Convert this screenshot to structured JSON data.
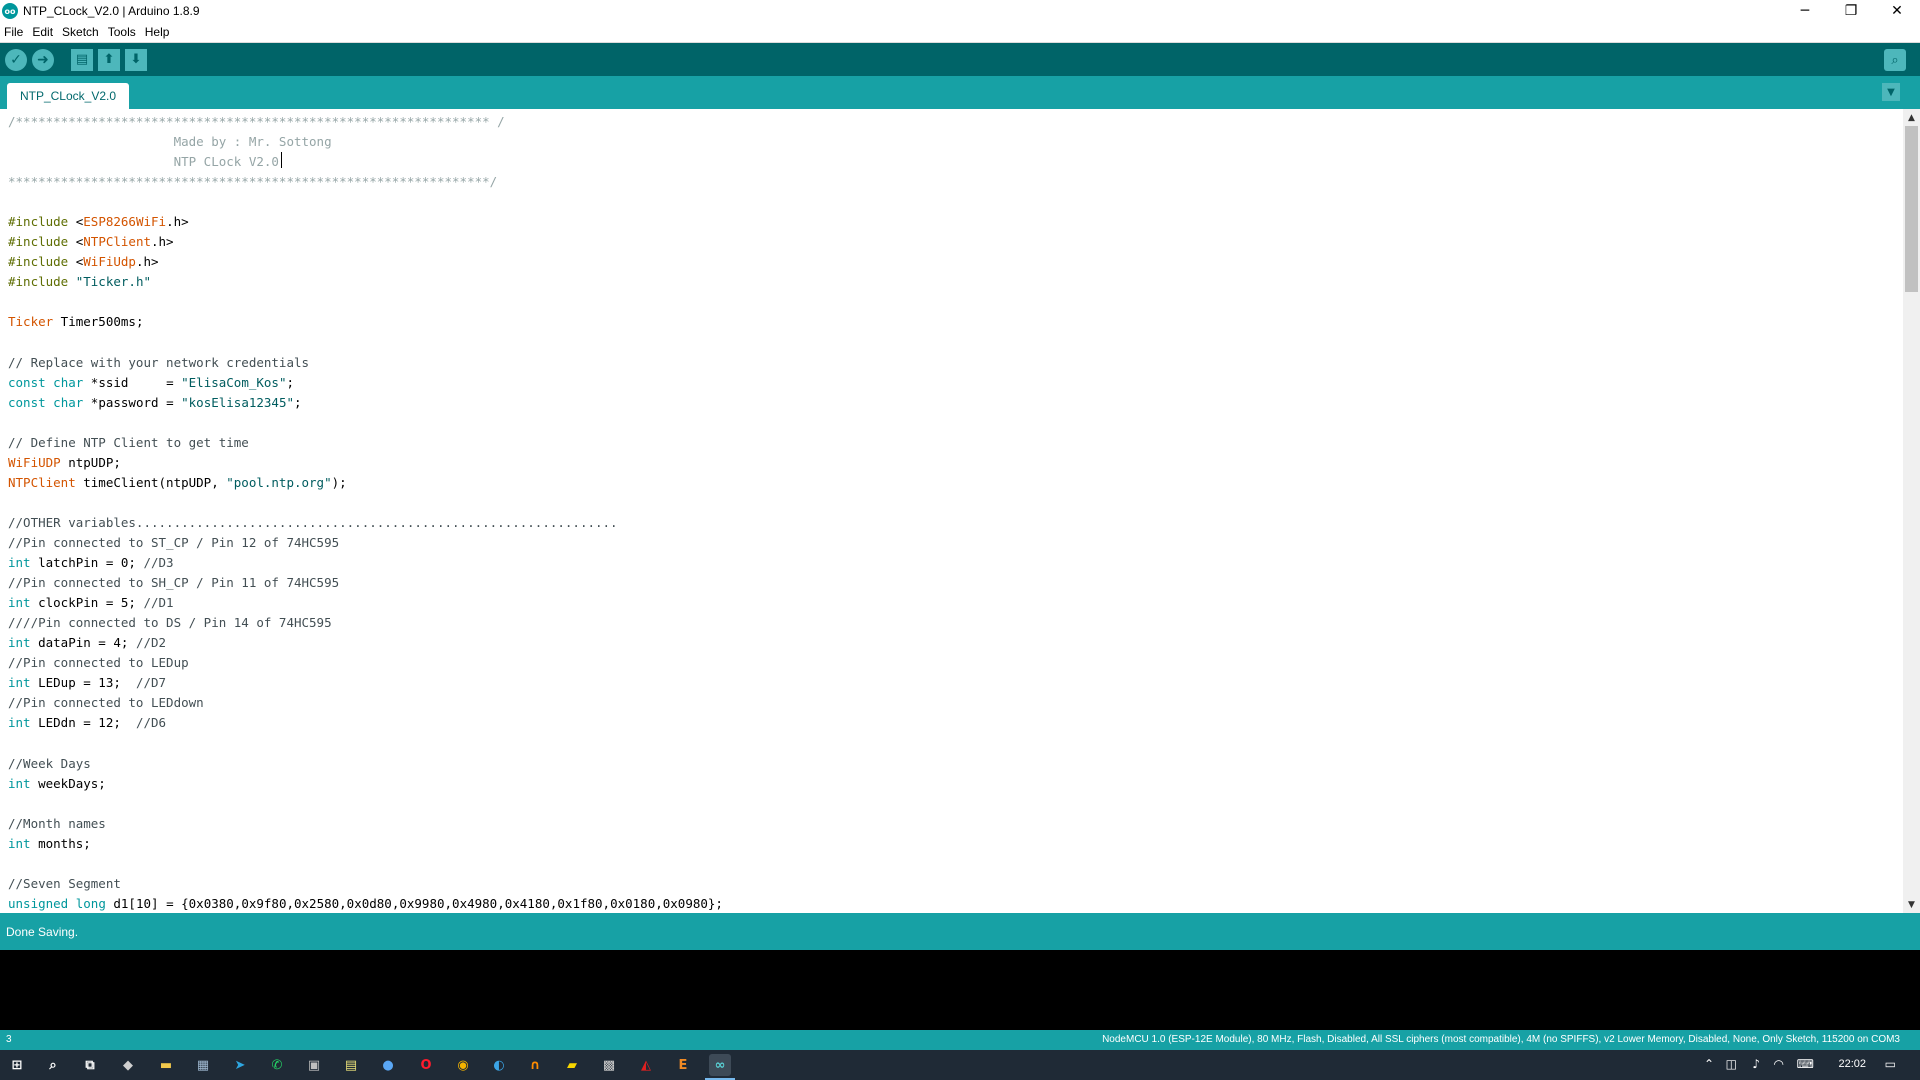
{
  "window": {
    "title": "NTP_CLock_V2.0 | Arduino 1.8.9",
    "logo_text": "oo",
    "minimize": "─",
    "maximize": "❐",
    "close": "✕"
  },
  "menu": [
    "File",
    "Edit",
    "Sketch",
    "Tools",
    "Help"
  ],
  "toolbar": {
    "verify_icon": "✓",
    "upload_icon": "➜",
    "new_icon": "▤",
    "open_icon": "⬆",
    "save_icon": "⬇",
    "serial_monitor_icon": "⌕"
  },
  "tabs": {
    "active": "NTP_CLock_V2.0",
    "menu_icon": "▼"
  },
  "code_lines": [
    [
      [
        "c-stars",
        "/*************************************************************** /"
      ]
    ],
    [
      [
        "c-stars",
        "                      Made by : Mr. Sottong"
      ]
    ],
    [
      [
        "c-stars",
        "                      NTP CLock V2.0"
      ]
    ],
    [
      [
        "c-stars",
        "****************************************************************/"
      ]
    ],
    [],
    [
      [
        "c-pre",
        "#include "
      ],
      [
        "",
        "<"
      ],
      [
        "c-class",
        "ESP8266WiFi"
      ],
      [
        "",
        ".h>"
      ]
    ],
    [
      [
        "c-pre",
        "#include "
      ],
      [
        "",
        "<"
      ],
      [
        "c-class",
        "NTPClient"
      ],
      [
        "",
        ".h>"
      ]
    ],
    [
      [
        "c-pre",
        "#include "
      ],
      [
        "",
        "<"
      ],
      [
        "c-class",
        "WiFiUdp"
      ],
      [
        "",
        ".h>"
      ]
    ],
    [
      [
        "c-pre",
        "#include "
      ],
      [
        "c-str",
        "\"Ticker.h\""
      ]
    ],
    [],
    [
      [
        "c-class",
        "Ticker"
      ],
      [
        "",
        " Timer500ms;"
      ]
    ],
    [],
    [
      [
        "c-comment",
        "// Replace with your network credentials"
      ]
    ],
    [
      [
        "c-type",
        "const"
      ],
      [
        "",
        " "
      ],
      [
        "c-type",
        "char"
      ],
      [
        "",
        " *ssid     = "
      ],
      [
        "c-str",
        "\"ElisaCom_Kos\""
      ],
      [
        "",
        ";"
      ]
    ],
    [
      [
        "c-type",
        "const"
      ],
      [
        "",
        " "
      ],
      [
        "c-type",
        "char"
      ],
      [
        "",
        " *password = "
      ],
      [
        "c-str",
        "\"kosElisa12345\""
      ],
      [
        "",
        ";"
      ]
    ],
    [],
    [
      [
        "c-comment",
        "// Define NTP Client to get time"
      ]
    ],
    [
      [
        "c-class",
        "WiFiUDP"
      ],
      [
        "",
        " ntpUDP;"
      ]
    ],
    [
      [
        "c-class",
        "NTPClient"
      ],
      [
        "",
        " timeClient(ntpUDP, "
      ],
      [
        "c-str",
        "\"pool.ntp.org\""
      ],
      [
        "",
        ");"
      ]
    ],
    [],
    [
      [
        "c-comment",
        "//OTHER variables................................................................"
      ]
    ],
    [
      [
        "c-comment",
        "//Pin connected to ST_CP / Pin 12 of 74HC595"
      ]
    ],
    [
      [
        "c-type",
        "int"
      ],
      [
        "",
        " latchPin = 0; "
      ],
      [
        "c-comment",
        "//D3"
      ]
    ],
    [
      [
        "c-comment",
        "//Pin connected to SH_CP / Pin 11 of 74HC595"
      ]
    ],
    [
      [
        "c-type",
        "int"
      ],
      [
        "",
        " clockPin = 5; "
      ],
      [
        "c-comment",
        "//D1"
      ]
    ],
    [
      [
        "c-comment",
        "////Pin connected to DS / Pin 14 of 74HC595"
      ]
    ],
    [
      [
        "c-type",
        "int"
      ],
      [
        "",
        " dataPin = 4; "
      ],
      [
        "c-comment",
        "//D2"
      ]
    ],
    [
      [
        "c-comment",
        "//Pin connected to LEDup"
      ]
    ],
    [
      [
        "c-type",
        "int"
      ],
      [
        "",
        " LEDup = 13;  "
      ],
      [
        "c-comment",
        "//D7"
      ]
    ],
    [
      [
        "c-comment",
        "//Pin connected to LEDdown"
      ]
    ],
    [
      [
        "c-type",
        "int"
      ],
      [
        "",
        " LEDdn = 12;  "
      ],
      [
        "c-comment",
        "//D6"
      ]
    ],
    [],
    [
      [
        "c-comment",
        "//Week Days"
      ]
    ],
    [
      [
        "c-type",
        "int"
      ],
      [
        "",
        " weekDays;"
      ]
    ],
    [],
    [
      [
        "c-comment",
        "//Month names"
      ]
    ],
    [
      [
        "c-type",
        "int"
      ],
      [
        "",
        " months;"
      ]
    ],
    [],
    [
      [
        "c-comment",
        "//Seven Segment"
      ]
    ],
    [
      [
        "c-type",
        "unsigned"
      ],
      [
        "",
        " "
      ],
      [
        "c-type",
        "long"
      ],
      [
        "",
        " d1[10] = {0x0380,0x9f80,0x2580,0x0d80,0x9980,0x4980,0x4180,0x1f80,0x0180,0x0980};"
      ]
    ]
  ],
  "scrollbar": {
    "up": "▲",
    "down": "▼"
  },
  "status": {
    "message": "Done Saving."
  },
  "footer": {
    "line_number": "3",
    "board_info": "NodeMCU 1.0 (ESP-12E Module), 80 MHz, Flash, Disabled, All SSL ciphers (most compatible), 4M (no SPIFFS), v2 Lower Memory, Disabled, None, Only Sketch, 115200 on COM3"
  },
  "taskbar": {
    "apps": [
      {
        "name": "start-icon",
        "glyph": "⊞",
        "color": "#ffffff"
      },
      {
        "name": "search-icon",
        "glyph": "⌕",
        "color": "#ffffff"
      },
      {
        "name": "task-view-icon",
        "glyph": "⧉",
        "color": "#ffffff"
      },
      {
        "name": "app-icon-1",
        "glyph": "◆",
        "color": "#cfcfcf"
      },
      {
        "name": "file-explorer-icon",
        "glyph": "▬",
        "color": "#f2c94c"
      },
      {
        "name": "calculator-icon",
        "glyph": "▦",
        "color": "#9fb8d0"
      },
      {
        "name": "telegram-icon",
        "glyph": "➤",
        "color": "#2ea6e0"
      },
      {
        "name": "whatsapp-icon",
        "glyph": "✆",
        "color": "#25d366"
      },
      {
        "name": "app-icon-2",
        "glyph": "▣",
        "color": "#bfbfbf"
      },
      {
        "name": "notes-icon",
        "glyph": "▤",
        "color": "#e8e07a"
      },
      {
        "name": "messenger-icon",
        "glyph": "●",
        "color": "#5aa7f5"
      },
      {
        "name": "opera-icon",
        "glyph": "O",
        "color": "#ff1b2d"
      },
      {
        "name": "chrome-icon",
        "glyph": "◉",
        "color": "#f4b400"
      },
      {
        "name": "edge-icon",
        "glyph": "◐",
        "color": "#3ba4e6"
      },
      {
        "name": "app-icon-3",
        "glyph": "∩",
        "color": "#ff8c00"
      },
      {
        "name": "sticky-notes-icon",
        "glyph": "▰",
        "color": "#f7d600"
      },
      {
        "name": "app-icon-4",
        "glyph": "▩",
        "color": "#d0d0d0"
      },
      {
        "name": "acrobat-icon",
        "glyph": "◭",
        "color": "#e02020"
      },
      {
        "name": "app-icon-5",
        "glyph": "E",
        "color": "#f08a24"
      },
      {
        "name": "arduino-icon",
        "glyph": "∞",
        "color": "#5ad2d6"
      }
    ],
    "tray": {
      "chevron": "⌃",
      "meet_now": "◫",
      "volume": "♪",
      "wifi": "◠",
      "keyboard": "⌨",
      "time": "22:02",
      "notification": "▭"
    }
  },
  "colors": {
    "toolbar_bg": "#006468",
    "tabstrip_bg": "#17a1a5",
    "status_bg": "#17a1a5",
    "console_bg": "#000000",
    "taskbar_bg": "#1f2a36"
  }
}
